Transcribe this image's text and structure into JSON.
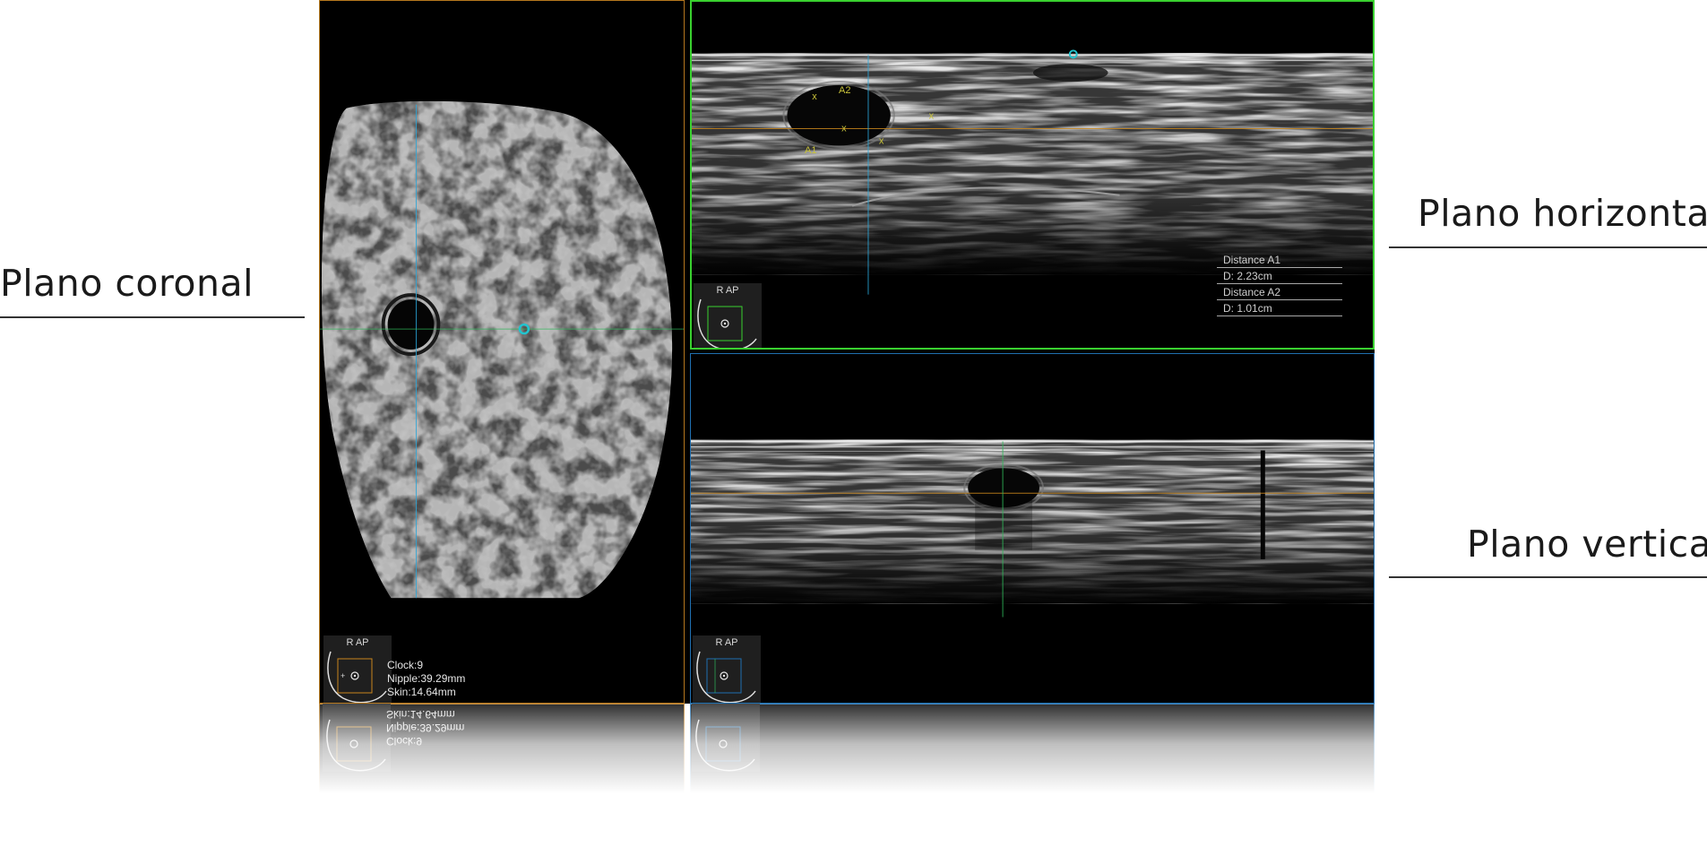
{
  "labels": {
    "coronal": "Plano coronal",
    "horizontal": "Plano horizontal",
    "vertical": "Plano vertical"
  },
  "panels": {
    "coronal": {
      "orientation": "R AP",
      "clock": "Clock:9",
      "nipple": "Nipple:39.29mm",
      "skin": "Skin:14.64mm",
      "frame_color": "#b5781e"
    },
    "horizontal": {
      "orientation": "R AP",
      "frame_color": "#39d12f",
      "markers": [
        "A2",
        "A1"
      ],
      "measurements": [
        {
          "name": "Distance A1",
          "value": "D: 2.23cm"
        },
        {
          "name": "Distance A2",
          "value": "D: 1.01cm"
        }
      ]
    },
    "vertical": {
      "orientation": "R AP",
      "frame_color": "#1f6fb0"
    }
  },
  "icons": [
    "nipple-target-icon",
    "breast-outline-icon",
    "crosshair-cursor-icon"
  ],
  "colors": {
    "crosshair_blue": "#2aa6d9",
    "crosshair_orange": "#c8861c",
    "crosshair_green": "#2fb85a",
    "cursor_cyan": "#22c4cf",
    "marker_yellow": "#c8c23a"
  }
}
